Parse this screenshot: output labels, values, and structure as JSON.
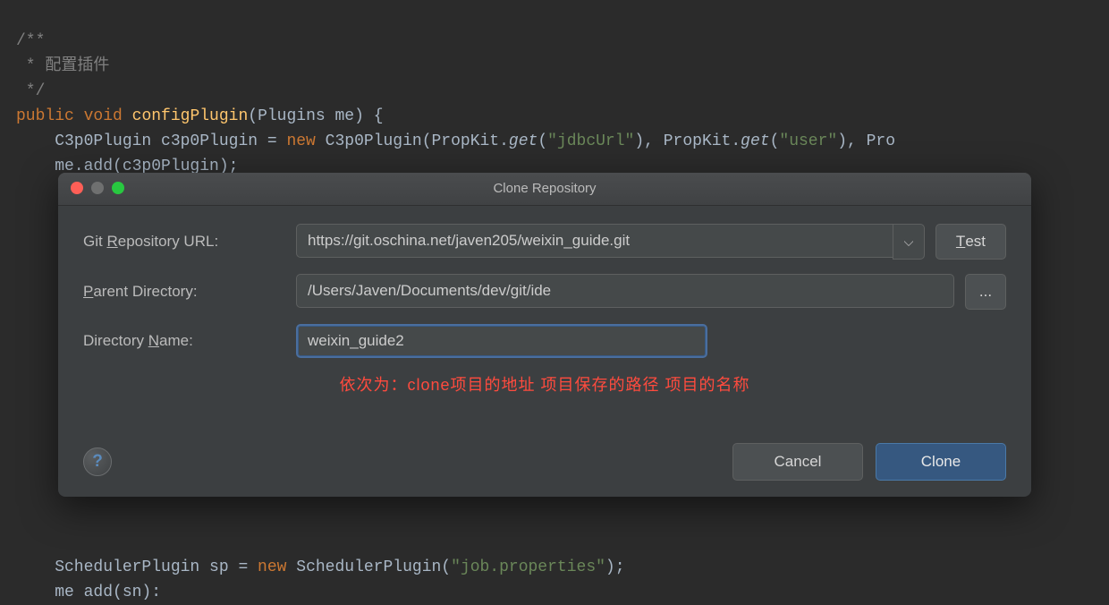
{
  "code": {
    "l1": "/**",
    "l2": " * 配置插件",
    "l3": " */",
    "l4_kw1": "public ",
    "l4_kw2": "void ",
    "l4_fn": "configPlugin",
    "l4_rest": "(Plugins me) {",
    "l5a": "    C3p0Plugin c3p0Plugin = ",
    "l5_new": "new ",
    "l5b": "C3p0Plugin(PropKit.",
    "l5_get1": "get",
    "l5c": "(",
    "l5_s1": "\"jdbcUrl\"",
    "l5d": "), PropKit.",
    "l5_get2": "get",
    "l5e": "(",
    "l5_s2": "\"user\"",
    "l5f": "), Pro",
    "l6": "    me.add(c3p0Plugin);",
    "l10a": "    SchedulerPlugin sp = ",
    "l10_new": "new ",
    "l10b": "SchedulerPlugin(",
    "l10_s": "\"job.properties\"",
    "l10c": ");",
    "l11": "    me add(sn):"
  },
  "dialog": {
    "title": "Clone Repository",
    "labels": {
      "url_pre": "Git ",
      "url_mn": "R",
      "url_post": "epository URL:",
      "parent_mn": "P",
      "parent_post": "arent Directory:",
      "dir_pre": "Directory ",
      "dir_mn": "N",
      "dir_post": "ame:"
    },
    "values": {
      "url": "https://git.oschina.net/javen205/weixin_guide.git",
      "parent": "/Users/Javen/Documents/dev/git/ide",
      "dirname": "weixin_guide2"
    },
    "buttons": {
      "test_mn": "T",
      "test_post": "est",
      "browse": "...",
      "cancel": "Cancel",
      "clone": "Clone",
      "help": "?"
    },
    "annotation": "依次为：clone项目的地址  项目保存的路径  项目的名称"
  }
}
